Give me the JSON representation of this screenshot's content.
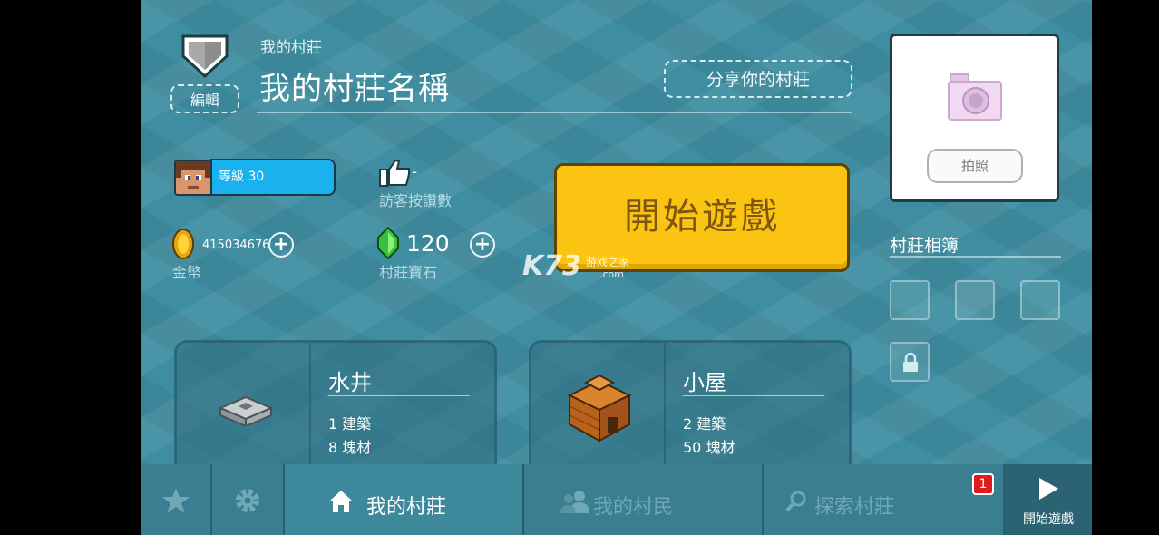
{
  "header": {
    "edit_label": "編輯",
    "subtitle": "我的村莊",
    "village_name": "我的村莊名稱",
    "share_label": "分享你的村莊"
  },
  "stats": {
    "level_text": "等級 30",
    "likes_value": "-",
    "likes_label": "訪客按讚數",
    "coins_value": "415034676",
    "coins_label": "金幣",
    "gems_value": "120",
    "gems_label": "村莊寶石"
  },
  "play_button_label": "開始遊戲",
  "watermark": {
    "logo": "K73",
    "sub": "游戏之家",
    "domain": ".com"
  },
  "buildings": [
    {
      "name": "水井",
      "builds": "1 建築",
      "blocks": "8 塊材"
    },
    {
      "name": "小屋",
      "builds": "2 建築",
      "blocks": "50 塊材"
    }
  ],
  "photo": {
    "button_label": "拍照"
  },
  "album": {
    "title": "村莊相簿",
    "locked_slots": 1
  },
  "nav": {
    "tabs": [
      {
        "label": "我的村莊",
        "icon": "home-icon",
        "active": true
      },
      {
        "label": "我的村民",
        "icon": "villagers-icon",
        "active": false
      },
      {
        "label": "探索村莊",
        "icon": "search-icon",
        "active": false
      }
    ],
    "badge_count": "1",
    "play_label": "開始遊戲"
  },
  "colors": {
    "background": "#3e8da0",
    "play_button": "#fbc412",
    "level_bar": "#1ab2ee",
    "badge": "#e11b1b"
  }
}
